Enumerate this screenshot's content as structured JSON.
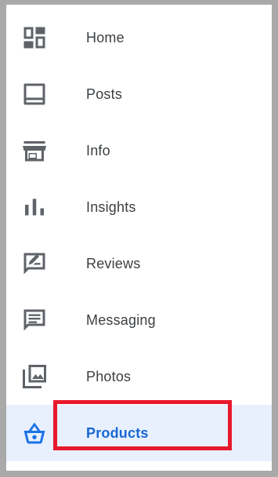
{
  "nav": {
    "items": [
      {
        "label": "Home",
        "icon": "dashboard-icon"
      },
      {
        "label": "Posts",
        "icon": "posts-icon"
      },
      {
        "label": "Info",
        "icon": "storefront-icon"
      },
      {
        "label": "Insights",
        "icon": "bar-chart-icon"
      },
      {
        "label": "Reviews",
        "icon": "rate-review-icon"
      },
      {
        "label": "Messaging",
        "icon": "message-icon"
      },
      {
        "label": "Photos",
        "icon": "photo-library-icon"
      },
      {
        "label": "Products",
        "icon": "shopping-basket-icon",
        "active": true
      }
    ]
  },
  "colors": {
    "icon_default": "#5f6368",
    "icon_active": "#1a73e8",
    "active_bg": "#e8f0fe",
    "highlight": "#e8192c"
  }
}
